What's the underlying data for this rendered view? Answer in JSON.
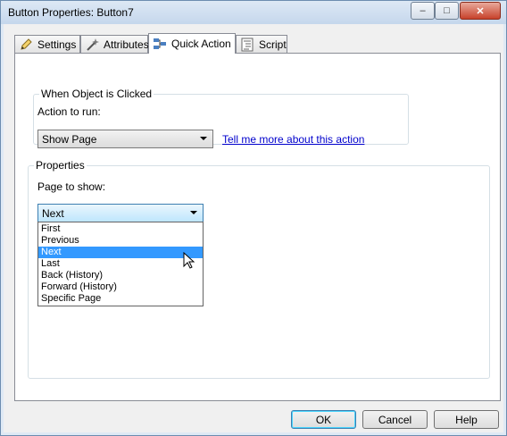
{
  "window": {
    "title": "Button Properties: Button7"
  },
  "titlebar_buttons": {
    "minimize": "–",
    "maximize": "□",
    "close": "✕"
  },
  "tabs": [
    {
      "label": "Settings",
      "icon": "pencil-icon"
    },
    {
      "label": "Attributes",
      "icon": "wand-icon"
    },
    {
      "label": "Quick Action",
      "icon": "flow-icon",
      "active": true
    },
    {
      "label": "Script",
      "icon": "script-icon"
    }
  ],
  "when_clicked": {
    "group_label": "When Object is Clicked",
    "action_label": "Action to run:",
    "action_value": "Show Page",
    "help_link": "Tell me more about this action"
  },
  "properties": {
    "group_label": "Properties",
    "page_label": "Page to show:",
    "page_value": "Next",
    "options": [
      "First",
      "Previous",
      "Next",
      "Last",
      "Back (History)",
      "Forward (History)",
      "Specific Page"
    ],
    "selected_option": "Next"
  },
  "buttons": {
    "ok": "OK",
    "cancel": "Cancel",
    "help": "Help"
  },
  "colors": {
    "selection": "#3399ff",
    "link": "#0000cc",
    "titlebar": "#c5d7ec"
  }
}
